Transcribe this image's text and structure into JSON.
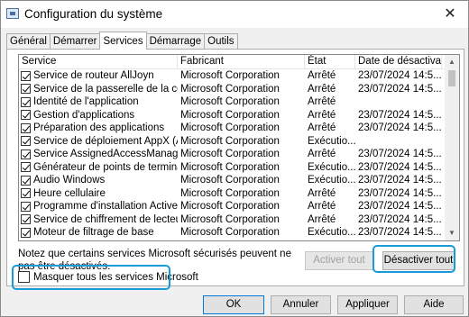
{
  "window": {
    "title": "Configuration du système",
    "close": "✕"
  },
  "tabs": [
    "Général",
    "Démarrer",
    "Services",
    "Démarrage",
    "Outils"
  ],
  "columns": [
    "Service",
    "Fabricant",
    "État",
    "Date de désactiva..."
  ],
  "rows": [
    {
      "service": "Service de routeur AllJoyn",
      "maker": "Microsoft Corporation",
      "state": "Arrêté",
      "date": "23/07/2024 14:5..."
    },
    {
      "service": "Service de la passerelle de la couc...",
      "maker": "Microsoft Corporation",
      "state": "Arrêté",
      "date": "23/07/2024 14:5..."
    },
    {
      "service": "Identité de l'application",
      "maker": "Microsoft Corporation",
      "state": "Arrêté",
      "date": ""
    },
    {
      "service": "Gestion d'applications",
      "maker": "Microsoft Corporation",
      "state": "Arrêté",
      "date": "23/07/2024 14:5..."
    },
    {
      "service": "Préparation des applications",
      "maker": "Microsoft Corporation",
      "state": "Arrêté",
      "date": "23/07/2024 14:5..."
    },
    {
      "service": "Service de déploiement AppX (Ap...",
      "maker": "Microsoft Corporation",
      "state": "Exécutio...",
      "date": ""
    },
    {
      "service": "Service AssignedAccessManager",
      "maker": "Microsoft Corporation",
      "state": "Arrêté",
      "date": "23/07/2024 14:5..."
    },
    {
      "service": "Générateur de points de terminais...",
      "maker": "Microsoft Corporation",
      "state": "Exécutio...",
      "date": "23/07/2024 14:5..."
    },
    {
      "service": "Audio Windows",
      "maker": "Microsoft Corporation",
      "state": "Exécutio...",
      "date": "23/07/2024 14:5..."
    },
    {
      "service": "Heure cellulaire",
      "maker": "Microsoft Corporation",
      "state": "Arrêté",
      "date": "23/07/2024 14:5..."
    },
    {
      "service": "Programme d'installation ActiveX ...",
      "maker": "Microsoft Corporation",
      "state": "Arrêté",
      "date": "23/07/2024 14:5..."
    },
    {
      "service": "Service de chiffrement de lecteur ...",
      "maker": "Microsoft Corporation",
      "state": "Arrêté",
      "date": "23/07/2024 14:5..."
    },
    {
      "service": "Moteur de filtrage de base",
      "maker": "Microsoft Corporation",
      "state": "Exécutio...",
      "date": "23/07/2024 14:5..."
    }
  ],
  "note": "Notez que certains services Microsoft sécurisés peuvent ne pas être désactivés.",
  "buttons": {
    "enable_all": "Activer tout",
    "disable_all": "Désactiver tout",
    "ok": "OK",
    "cancel": "Annuler",
    "apply": "Appliquer",
    "help": "Aide"
  },
  "hide_ms": {
    "label": "Masquer tous les services Microsoft",
    "checked": false
  },
  "colors": {
    "highlight": "#1a9bd7",
    "default_button": "#0078d7"
  }
}
